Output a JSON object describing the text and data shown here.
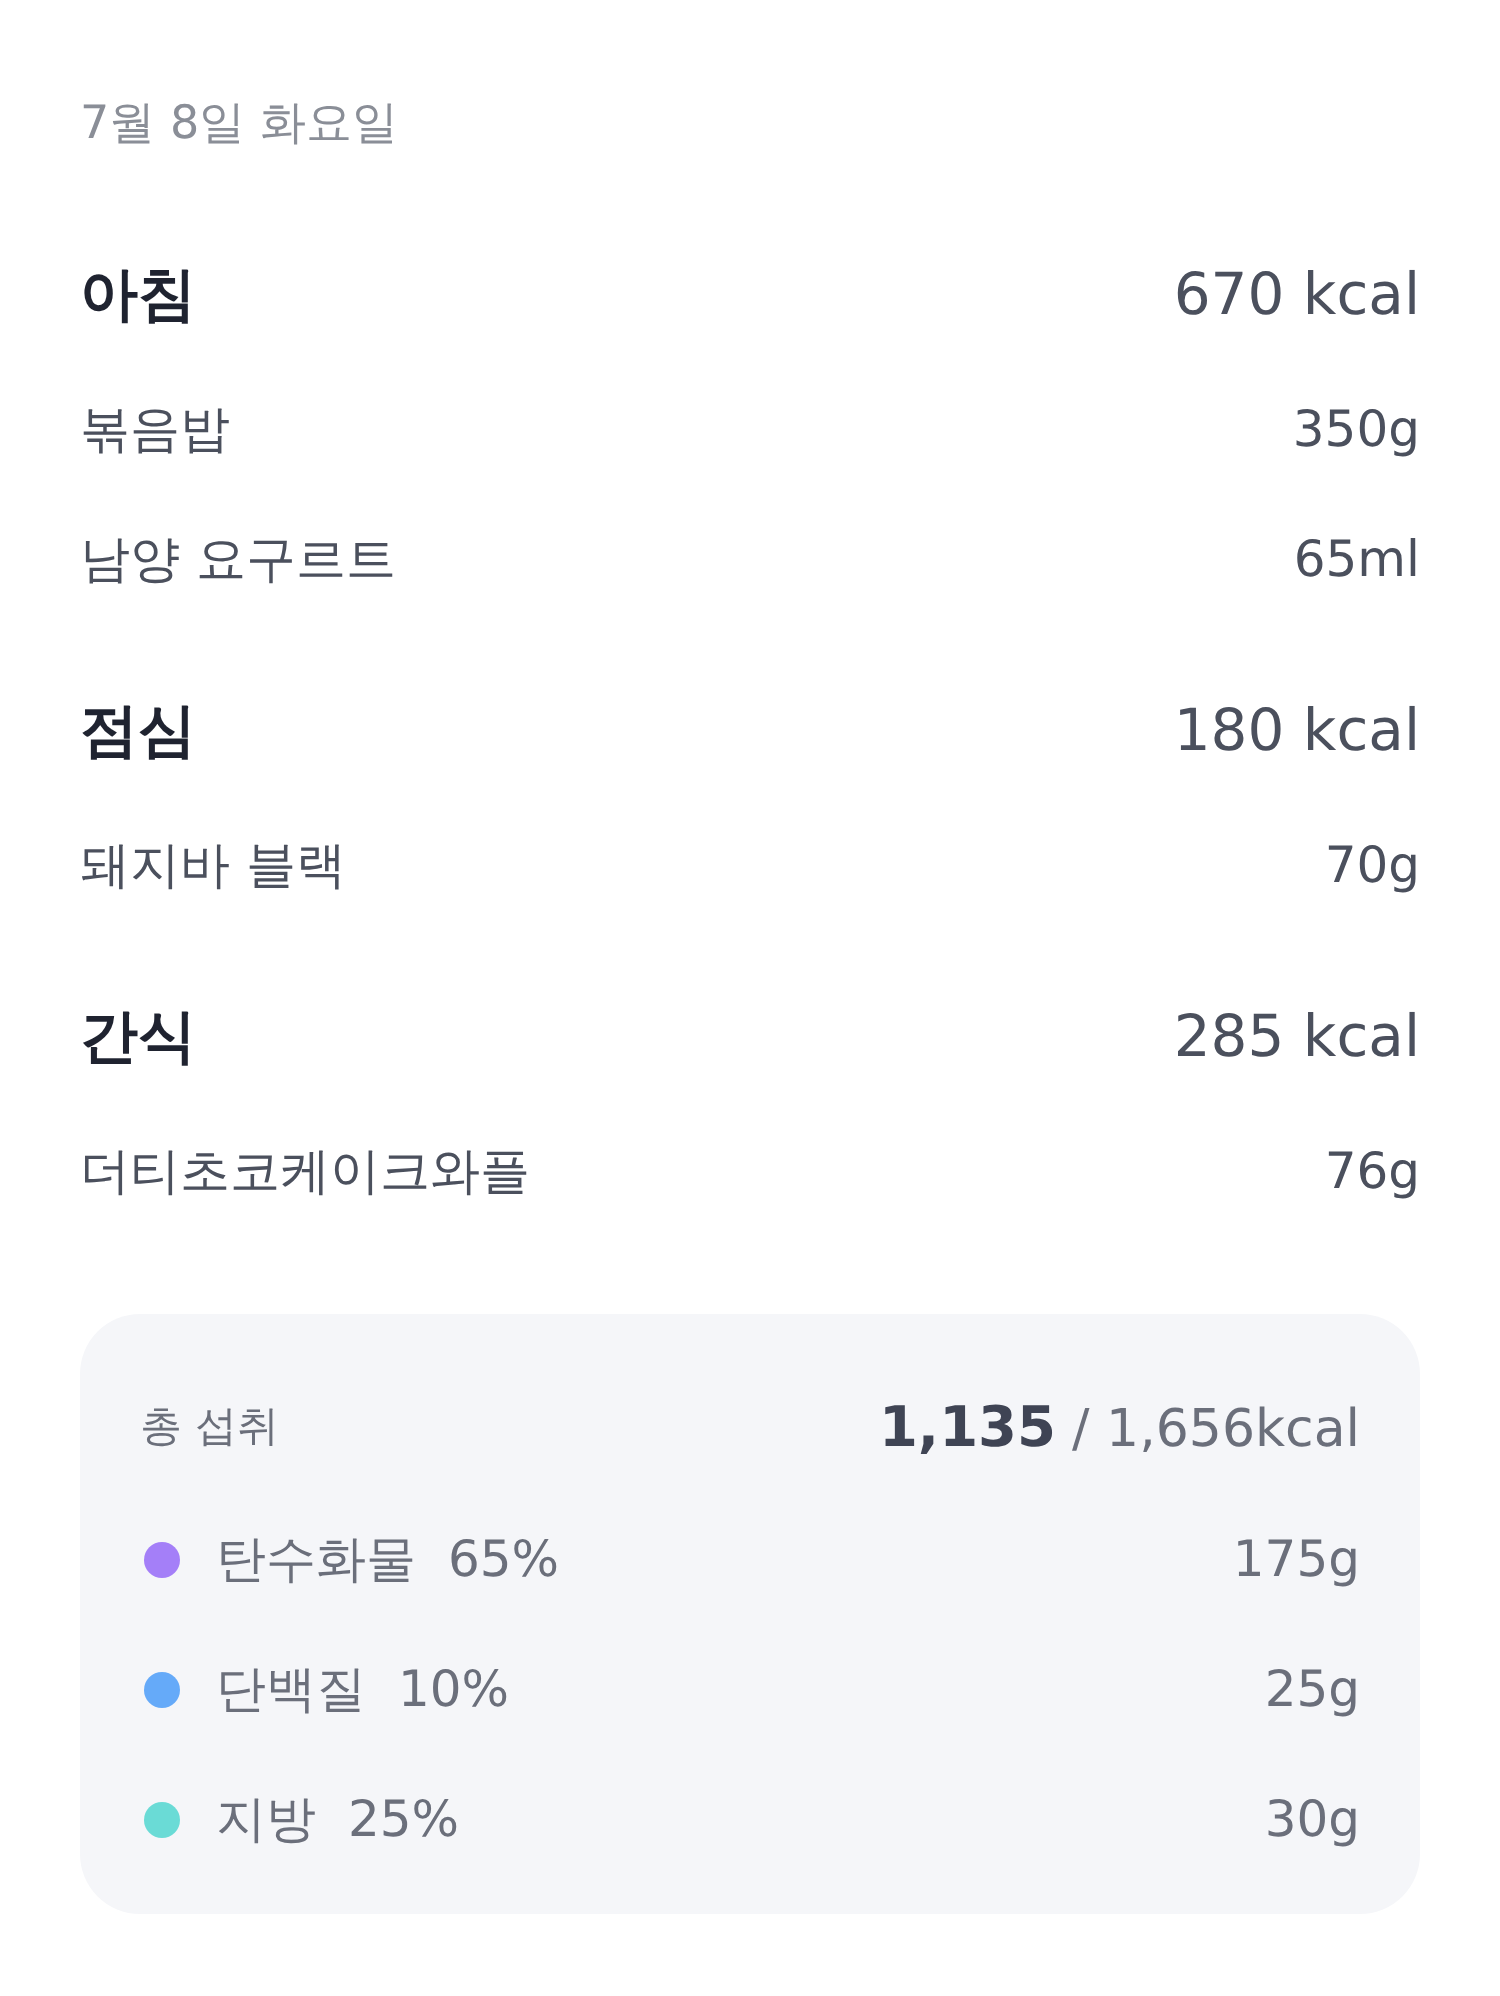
{
  "date": "7월 8일 화요일",
  "meals": [
    {
      "name": "아침",
      "calories": "670 kcal",
      "items": [
        {
          "name": "볶음밥",
          "amount": "350g"
        },
        {
          "name": "남양 요구르트",
          "amount": "65ml"
        }
      ]
    },
    {
      "name": "점심",
      "calories": "180 kcal",
      "items": [
        {
          "name": "돼지바 블랙",
          "amount": "70g"
        }
      ]
    },
    {
      "name": "간식",
      "calories": "285 kcal",
      "items": [
        {
          "name": "더티초코케이크와플",
          "amount": "76g"
        }
      ]
    }
  ],
  "summary": {
    "label": "총 섭취",
    "consumed": "1,135",
    "goal": "/ 1,656kcal",
    "macros": [
      {
        "name": "탄수화물",
        "percent": "65%",
        "amount": "175g",
        "color": "#a47ff8"
      },
      {
        "name": "단백질",
        "percent": "10%",
        "amount": "25g",
        "color": "#65aaf9"
      },
      {
        "name": "지방",
        "percent": "25%",
        "amount": "30g",
        "color": "#6adbd6"
      }
    ]
  }
}
